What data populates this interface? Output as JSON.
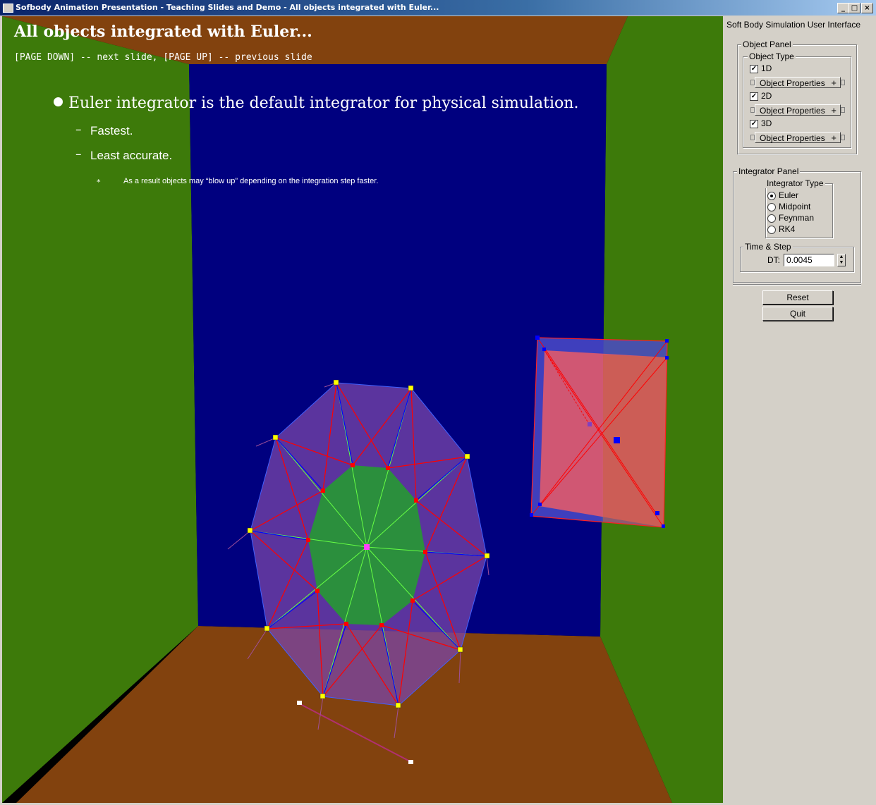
{
  "window": {
    "title": "Sofbody Animation Presentation - Teaching Slides and Demo - All objects integrated with Euler...",
    "minimize": "_",
    "maximize": "□",
    "close": "×"
  },
  "slide": {
    "title": "All objects integrated with Euler...",
    "hint": "[PAGE DOWN] -- next slide, [PAGE UP] -- previous slide",
    "bullet": "Euler integrator is the default integrator for physical simulation.",
    "dash": "–",
    "sub_bullets": [
      "Fastest.",
      "Least accurate."
    ],
    "star": "*",
    "note": "As a result objects may “blow up” depending on the integration step faster."
  },
  "panel": {
    "title": "Soft Body Simulation User Interface",
    "object_panel": {
      "label": "Object Panel",
      "type_label": "Object Type",
      "items": [
        {
          "label": "1D",
          "checked": true,
          "props_label": "Object Properties"
        },
        {
          "label": "2D",
          "checked": true,
          "props_label": "Object Properties"
        },
        {
          "label": "3D",
          "checked": true,
          "props_label": "Object Properties"
        }
      ],
      "plus": "+",
      "check_mark": "✓"
    },
    "integrator_panel": {
      "label": "Integrator Panel",
      "type_label": "Integrator Type",
      "options": [
        "Euler",
        "Midpoint",
        "Feynman",
        "RK4"
      ],
      "selected": "Euler",
      "time_label": "Time & Step",
      "dt_label": "DT:",
      "dt_value": "0.0045",
      "spin_up": "▲",
      "spin_down": "▼"
    },
    "buttons": {
      "reset": "Reset",
      "quit": "Quit"
    }
  },
  "scene_colors": {
    "side_walls": "#3d7a0a",
    "floor_ceiling": "#82420e",
    "back_wall": "#00007f",
    "blob_outer": "#7a46a8",
    "blob_inner": "#2b8f3d",
    "cube_face": "#e05a6a",
    "spring_red": "#ff0000",
    "spring_blue": "#0000ff",
    "spring_green": "#66ff44",
    "mass_yellow": "#ffff00"
  }
}
